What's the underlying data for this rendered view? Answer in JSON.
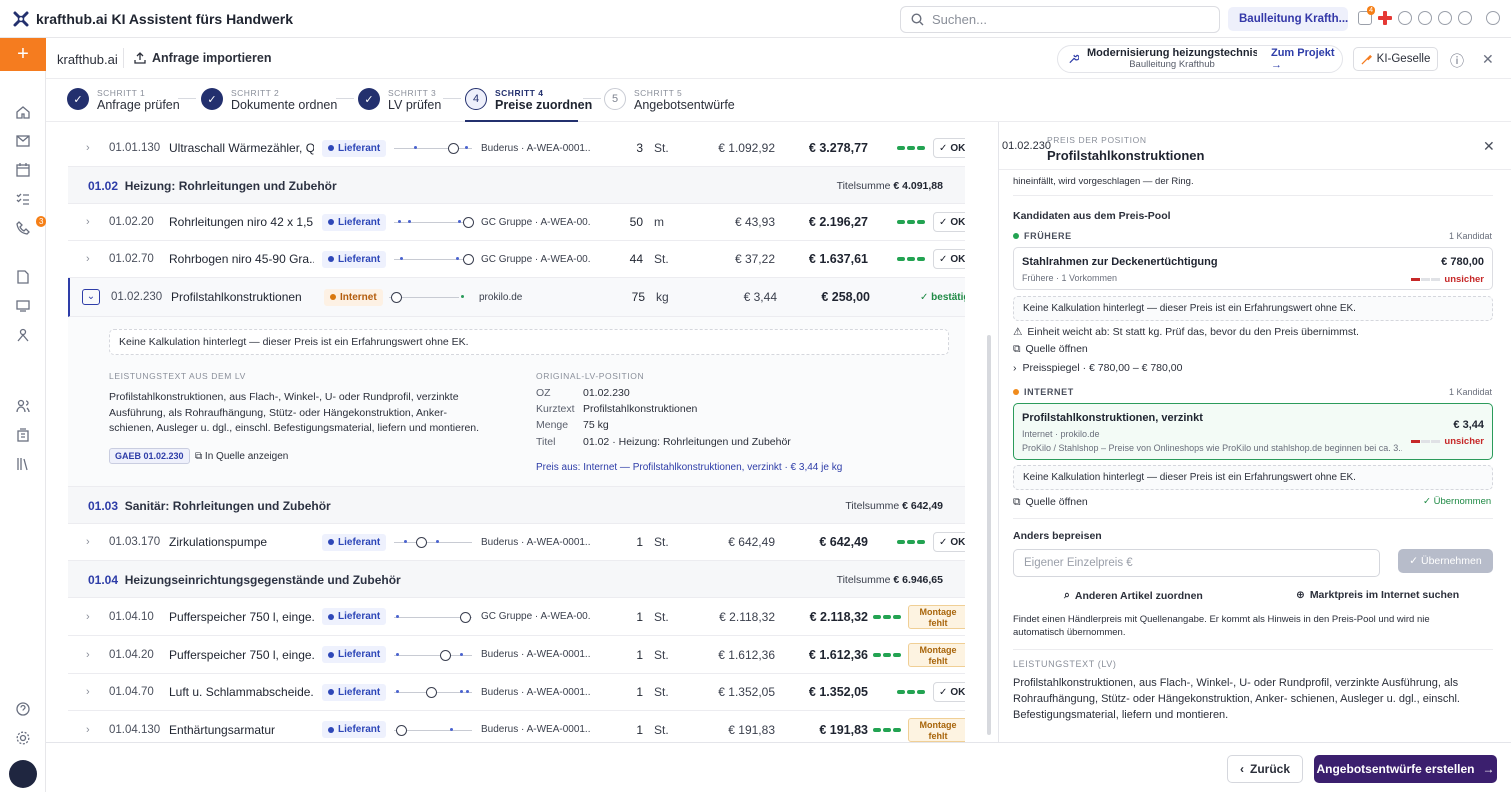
{
  "app": {
    "title": "krafthub.ai KI Assistent fürs Handwerk",
    "search_placeholder": "Suchen...",
    "org": "Baulleitung Krafth...",
    "notif_count": "4"
  },
  "sidebar": {
    "badge": "3"
  },
  "subbar": {
    "brand": "krafthub.ai",
    "import": "Anfrage importieren",
    "project_title": "Modernisierung heizungstechnisc...",
    "project_sub": "Baulleitung Krafthub",
    "zum_projekt": "Zum Projekt →",
    "ki": "KI-Geselle"
  },
  "steps": [
    {
      "num": "SCHRITT 1",
      "name": "Anfrage prüfen",
      "marker": "✓"
    },
    {
      "num": "SCHRITT 2",
      "name": "Dokumente ordnen",
      "marker": "✓"
    },
    {
      "num": "SCHRITT 3",
      "name": "LV prüfen",
      "marker": "✓"
    },
    {
      "num": "SCHRITT 4",
      "name": "Preise zuordnen",
      "marker": "4"
    },
    {
      "num": "SCHRITT 5",
      "name": "Angebotsentwürfe",
      "marker": "5"
    }
  ],
  "rows": [
    {
      "oz": "01.01.130",
      "name": "Ultraschall Wärmezähler, Q...",
      "badge": "Lieferant",
      "src": "Buderus · A-WEA-0001...",
      "qty": "3",
      "unit": "St.",
      "ep": "€ 1.092,92",
      "gp": "€ 3.278,77",
      "status": "OK"
    },
    {
      "oz": "01.02.20",
      "name": "Rohrleitungen niro 42 x 1,5...",
      "badge": "Lieferant",
      "src": "GC Gruppe · A-WEA-00...",
      "qty": "50",
      "unit": "m",
      "ep": "€ 43,93",
      "gp": "€ 2.196,27",
      "status": "OK"
    },
    {
      "oz": "01.02.70",
      "name": "Rohrbogen niro 45-90 Gra...",
      "badge": "Lieferant",
      "src": "GC Gruppe · A-WEA-00...",
      "qty": "44",
      "unit": "St.",
      "ep": "€ 37,22",
      "gp": "€ 1.637,61",
      "status": "OK"
    },
    {
      "oz": "01.02.230",
      "name": "Profilstahlkonstruktionen",
      "badge": "Internet",
      "src": "prokilo.de",
      "qty": "75",
      "unit": "kg",
      "ep": "€ 3,44",
      "gp": "€ 258,00",
      "status": "✓ bestätigt"
    },
    {
      "oz": "01.03.170",
      "name": "Zirkulationspumpe",
      "badge": "Lieferant",
      "src": "Buderus · A-WEA-0001...",
      "qty": "1",
      "unit": "St.",
      "ep": "€ 642,49",
      "gp": "€ 642,49",
      "status": "OK"
    },
    {
      "oz": "01.04.10",
      "name": "Pufferspeicher 750 l, einge...",
      "badge": "Lieferant",
      "src": "GC Gruppe · A-WEA-00...",
      "qty": "1",
      "unit": "St.",
      "ep": "€ 2.118,32",
      "gp": "€ 2.118,32",
      "status": "Montage fehlt"
    },
    {
      "oz": "01.04.20",
      "name": "Pufferspeicher 750 l, einge...",
      "badge": "Lieferant",
      "src": "Buderus · A-WEA-0001...",
      "qty": "1",
      "unit": "St.",
      "ep": "€ 1.612,36",
      "gp": "€ 1.612,36",
      "status": "Montage fehlt"
    },
    {
      "oz": "01.04.70",
      "name": "Luft u. Schlammabscheide...",
      "badge": "Lieferant",
      "src": "Buderus · A-WEA-0001...",
      "qty": "1",
      "unit": "St.",
      "ep": "€ 1.352,05",
      "gp": "€ 1.352,05",
      "status": "OK"
    },
    {
      "oz": "01.04.130",
      "name": "Enthärtungsarmatur",
      "badge": "Lieferant",
      "src": "Buderus · A-WEA-0001...",
      "qty": "1",
      "unit": "St.",
      "ep": "€ 191,83",
      "gp": "€ 191,83",
      "status": "Montage fehlt"
    }
  ],
  "groups": [
    {
      "code": "01.02",
      "name": "Heizung: Rohrleitungen und Zubehör",
      "sum_label": "Titelsumme",
      "sum": "€ 4.091,88"
    },
    {
      "code": "01.03",
      "name": "Sanitär: Rohrleitungen und Zubehör",
      "sum_label": "Titelsumme",
      "sum": "€ 642,49"
    },
    {
      "code": "01.04",
      "name": "Heizungseinrichtungsgegenstände und Zubehör",
      "sum_label": "Titelsumme",
      "sum": "€ 6.946,65"
    }
  ],
  "detail": {
    "hint": "Keine Kalkulation hinterlegt — dieser Preis ist ein Erfahrungswert ohne EK.",
    "lv_label": "LEISTUNGSTEXT AUS DEM LV",
    "lv_text": "Profilstahlkonstruktionen, aus Flach-, Winkel-, U- oder Rundprofil, verzinkte Ausführung, als Rohraufhängung, Stütz- oder Hängekonstruktion, Anker- schienen, Ausleger u. dgl., einschl. Befestigungsmaterial, liefern und montieren.",
    "gaeb": "GAEB 01.02.230",
    "quelle": "In Quelle anzeigen",
    "orig_label": "ORIGINAL-LV-POSITION",
    "kv": [
      {
        "k": "OZ",
        "v": "01.02.230"
      },
      {
        "k": "Kurztext",
        "v": "Profilstahlkonstruktionen"
      },
      {
        "k": "Menge",
        "v": "75 kg"
      },
      {
        "k": "Titel",
        "v": "01.02 · Heizung: Rohrleitungen und Zubehör"
      }
    ],
    "preis_aus": "Preis aus: Internet — Profilstahlkonstruktionen, verzinkt · € 3,44 je kg"
  },
  "panel": {
    "oz": "01.02.230",
    "label": "PREIS DER POSITION",
    "title": "Profilstahlkonstruktionen",
    "top_text": "hineinfällt, wird vorgeschlagen — der Ring.",
    "kandidaten": "Kandidaten aus dem Preis-Pool",
    "fruehere": "FRÜHERE",
    "fruehere_count": "1 Kandidat",
    "c1_name": "Stahlrahmen zur Deckenertüchtigung",
    "c1_sub": "Frühere · 1 Vorkommen",
    "c1_price": "€ 780,00",
    "c1_unsure": "unsicher",
    "hint1": "Keine Kalkulation hinterlegt — dieser Preis ist ein Erfahrungswert ohne EK.",
    "warn": "Einheit weicht ab: St statt kg. Prüf das, bevor du den Preis übernimmst.",
    "quelle1": "Quelle öffnen",
    "preisspiegel": "Preisspiegel · € 780,00 – € 780,00",
    "internet": "INTERNET",
    "internet_count": "1 Kandidat",
    "c2_name": "Profilstahlkonstruktionen, verzinkt",
    "c2_sub": "Internet · prokilo.de",
    "c2_desc": "ProKilo / Stahlshop – Preise von Onlineshops wie ProKilo und stahlshop.de beginnen bei ca. 3...",
    "c2_price": "€ 3,44",
    "c2_unsure": "unsicher",
    "hint2": "Keine Kalkulation hinterlegt — dieser Preis ist ein Erfahrungswert ohne EK.",
    "quelle2": "Quelle öffnen",
    "uebernommen": "✓ Übernommen",
    "anders": "Anders bepreisen",
    "eigener_placeholder": "Eigener Einzelpreis €",
    "uebernehmen": "✓ Übernehmen",
    "anderen": "Anderen Artikel zuordnen",
    "markt": "Marktpreis im Internet suchen",
    "markt_text": "Findet einen Händlerpreis mit Quellenangabe. Er kommt als Hinweis in den Preis-Pool und wird nie automatisch übernommen.",
    "lv_label": "LEISTUNGSTEXT (LV)",
    "lv_text": "Profilstahlkonstruktionen, aus Flach-, Winkel-, U- oder Rundprofil, verzinkte Ausführung, als Rohraufhängung, Stütz- oder Hängekonstruktion, Anker- schienen, Ausleger u. dgl., einschl. Befestigungsmaterial, liefern und montieren."
  },
  "footer": {
    "back": "Zurück",
    "next": "Angebotsentwürfe erstellen"
  }
}
